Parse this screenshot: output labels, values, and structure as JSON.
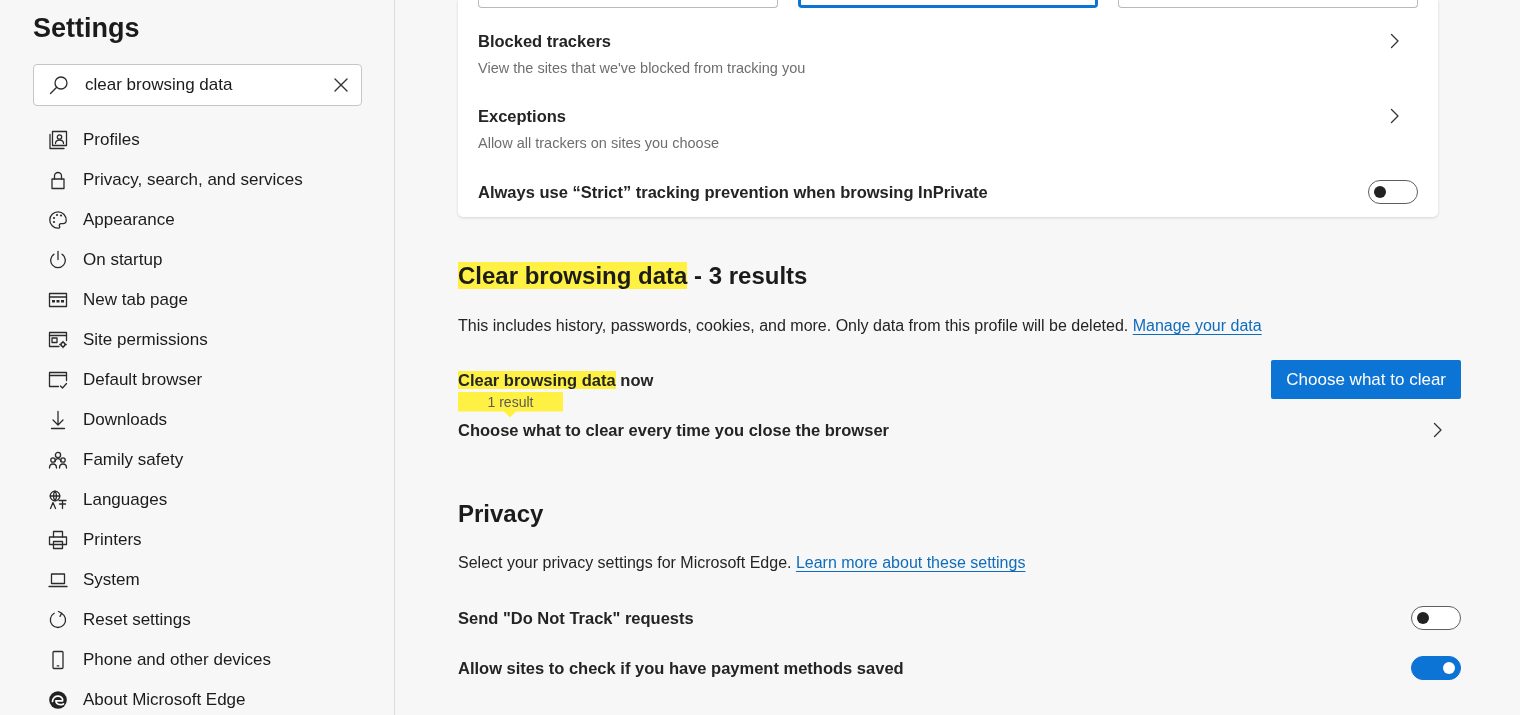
{
  "sidebar": {
    "title": "Settings",
    "search": {
      "value": "clear browsing data"
    },
    "items": [
      {
        "label": "Profiles"
      },
      {
        "label": "Privacy, search, and services"
      },
      {
        "label": "Appearance"
      },
      {
        "label": "On startup"
      },
      {
        "label": "New tab page"
      },
      {
        "label": "Site permissions"
      },
      {
        "label": "Default browser"
      },
      {
        "label": "Downloads"
      },
      {
        "label": "Family safety"
      },
      {
        "label": "Languages"
      },
      {
        "label": "Printers"
      },
      {
        "label": "System"
      },
      {
        "label": "Reset settings"
      },
      {
        "label": "Phone and other devices"
      },
      {
        "label": "About Microsoft Edge"
      }
    ]
  },
  "tracking": {
    "options": [
      {
        "selected": false
      },
      {
        "selected": true
      },
      {
        "selected": false
      }
    ],
    "rows": [
      {
        "kind": "link",
        "title": "Blocked trackers",
        "subtitle": "View the sites that we've blocked from tracking you"
      },
      {
        "kind": "link",
        "title": "Exceptions",
        "subtitle": "Allow all trackers on sites you choose"
      },
      {
        "kind": "toggle",
        "title": "Always use “Strict” tracking prevention when browsing InPrivate",
        "on": false
      }
    ]
  },
  "clear_browsing_data": {
    "heading": {
      "highlight": "Clear browsing data",
      "title": "- 3 results"
    },
    "description": "This includes history, passwords, cookies, and more. Only data from this profile will be deleted.",
    "link": "Manage your data",
    "rows": [
      {
        "kind": "button",
        "highlight": "Clear browsing data",
        "title": "now",
        "tooltip": "1 result",
        "button": "Choose what to clear"
      },
      {
        "kind": "link",
        "title": "Choose what to clear every time you close the browser"
      }
    ]
  },
  "privacy": {
    "heading": {
      "title": "Privacy"
    },
    "description": "Select your privacy settings for Microsoft Edge.",
    "link": "Learn more about these settings",
    "rows": [
      {
        "kind": "toggle",
        "title": "Send \"Do Not Track\" requests",
        "on": false
      },
      {
        "kind": "toggle",
        "title": "Allow sites to check if you have payment methods saved",
        "on": true
      }
    ]
  }
}
